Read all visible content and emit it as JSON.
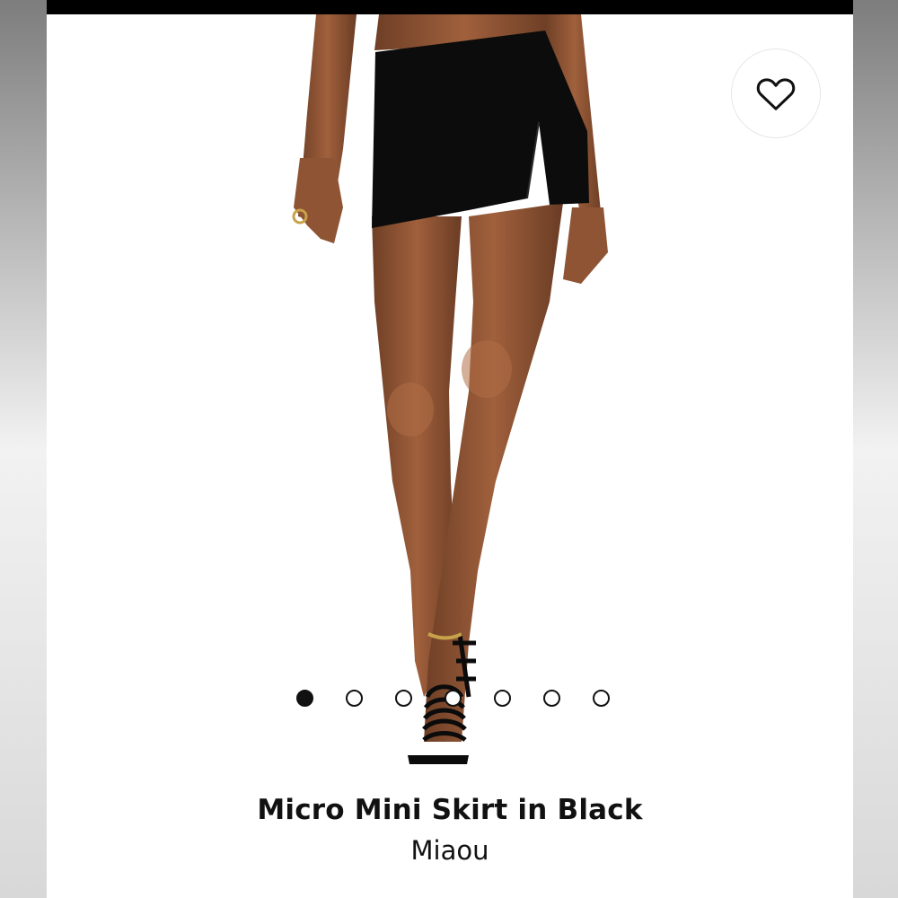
{
  "product": {
    "title": "Micro Mini Skirt in Black",
    "brand": "Miaou"
  },
  "gallery": {
    "image_count": 7,
    "active_index": 0,
    "favorite_icon": "heart-outline-icon"
  },
  "colors": {
    "skin": "#8a5234",
    "skirt": "#0c0c0c",
    "status_bar": "#000000"
  }
}
